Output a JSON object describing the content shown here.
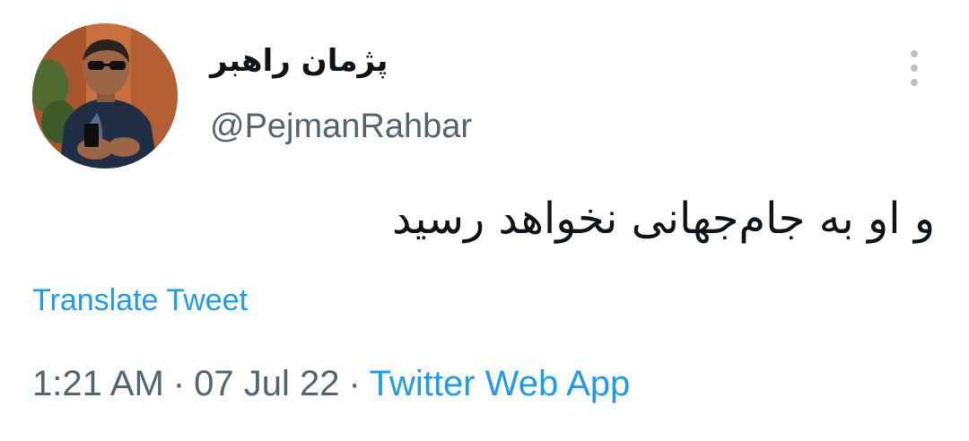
{
  "user": {
    "display_name": "پژمان راهبر",
    "handle": "@PejmanRahbar"
  },
  "tweet": {
    "text": "و او به جام‌جهانی نخواهد رسید",
    "translate_label": "Translate Tweet"
  },
  "meta": {
    "time": "1:21 AM",
    "separator": "·",
    "date": "07 Jul 22",
    "source": "Twitter Web App"
  },
  "colors": {
    "link": "#1d9bf0",
    "secondary_text": "#536471",
    "primary_text": "#0f1419"
  },
  "icons": {
    "more": "more-vertical-icon"
  }
}
